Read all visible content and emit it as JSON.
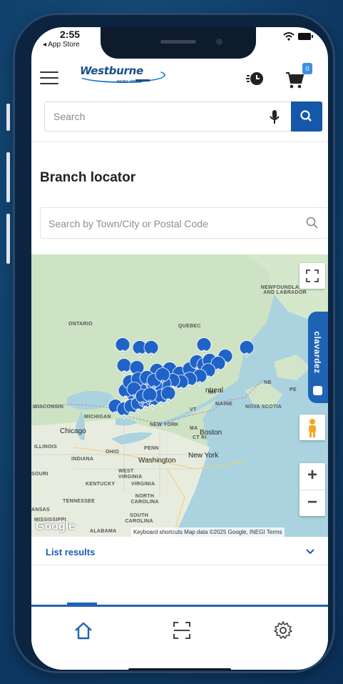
{
  "status_bar": {
    "time": "2:55",
    "back_app": "◂ App Store"
  },
  "header": {
    "logo_text": "Westburne",
    "logo_subtext": "REXEL GROUP",
    "cart_count": "0"
  },
  "search": {
    "placeholder": "Search"
  },
  "page": {
    "title": "Branch locator"
  },
  "locator": {
    "placeholder": "Search by Town/City or Postal Code"
  },
  "map": {
    "regions": [
      {
        "name": "ONTARIO"
      },
      {
        "name": "QUEBEC"
      },
      {
        "name": "NEWFOUNDLAND AND LABRADOR"
      },
      {
        "name": "NB"
      },
      {
        "name": "PE"
      },
      {
        "name": "NOVA SCOTIA"
      },
      {
        "name": "MAINE"
      },
      {
        "name": "WISCONSIN"
      },
      {
        "name": "MICHIGAN"
      },
      {
        "name": "ILLINOIS"
      },
      {
        "name": "INDIANA"
      },
      {
        "name": "OHIO"
      },
      {
        "name": "PENN"
      },
      {
        "name": "NEW YORK"
      },
      {
        "name": "NH"
      },
      {
        "name": "VT"
      },
      {
        "name": "MA"
      },
      {
        "name": "CT RI"
      },
      {
        "name": "WEST VIRGINIA"
      },
      {
        "name": "VIRGINIA"
      },
      {
        "name": "KENTUCKY"
      },
      {
        "name": "TENNESSEE"
      },
      {
        "name": "NORTH CAROLINA"
      },
      {
        "name": "SOUTH CAROLINA"
      },
      {
        "name": "MISSISSIPPI"
      },
      {
        "name": "ALABAMA"
      },
      {
        "name": "SOURI"
      },
      {
        "name": "ANSAS"
      }
    ],
    "cities": [
      {
        "name": "Chicago"
      },
      {
        "name": "Boston"
      },
      {
        "name": "New York"
      },
      {
        "name": "Washington"
      },
      {
        "name": "ntreal"
      }
    ],
    "google_logo": "Google",
    "attribution": "Keyboard shortcuts   Map data ©2025 Google, INEGI   Terms",
    "chat_widget_label": "clavardez"
  },
  "list": {
    "label": "List results"
  },
  "icons": {
    "menu": "hamburger-icon",
    "delivery": "clock-icon",
    "cart": "cart-icon",
    "mic": "mic-icon",
    "search": "search-icon",
    "location_search": "search-icon",
    "fullscreen": "fullscreen-icon",
    "pegman": "pegman-icon",
    "zoom_in": "+",
    "zoom_out": "−",
    "expand": "chevron-down-icon",
    "home": "home-icon",
    "scan": "scan-icon",
    "settings": "gear-icon"
  },
  "colors": {
    "accent": "#1f63b5",
    "search_button": "#1557a8",
    "map_pin": "#1f63c7"
  }
}
